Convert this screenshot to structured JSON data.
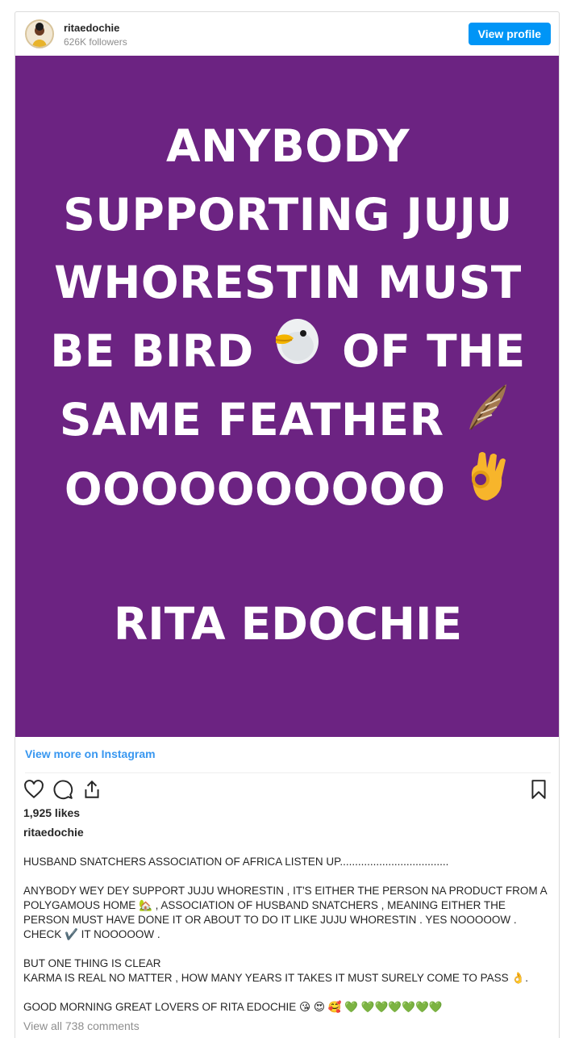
{
  "header": {
    "username": "ritaedochie",
    "followers": "626K followers",
    "view_profile_label": "View profile"
  },
  "post_image": {
    "background": "#6c2382",
    "lines": [
      "ANYBODY",
      "SUPPORTING JUJU",
      "WHORESTIN MUST",
      "BE BIRD",
      "OF THE",
      "SAME FEATHER",
      "OOOOOOOOOO",
      "RITA EDOCHIE"
    ],
    "emojis": [
      "bird-emoji",
      "feather-emoji",
      "ok-hand-emoji"
    ]
  },
  "links": {
    "view_more": "View more on Instagram",
    "view_all_comments": "View all 738 comments"
  },
  "actions": {
    "icons": [
      "heart-icon",
      "comment-icon",
      "share-icon",
      "bookmark-icon"
    ]
  },
  "stats": {
    "likes": "1,925 likes"
  },
  "caption": {
    "username": "ritaedochie",
    "p1": "HUSBAND SNATCHERS ASSOCIATION OF AFRICA LISTEN UP....................................",
    "p2": "ANYBODY WEY DEY SUPPORT JUJU WHORESTIN , IT'S EITHER THE PERSON NA PRODUCT FROM A POLYGAMOUS HOME 🏡 , ASSOCIATION OF HUSBAND SNATCHERS , MEANING EITHER THE PERSON MUST HAVE DONE IT OR ABOUT TO DO IT LIKE JUJU WHORESTIN . YES NOOOOOW . CHECK ✔️ IT NOOOOOW .",
    "p3a": "BUT ONE THING IS CLEAR",
    "p3b": "KARMA IS REAL NO MATTER , HOW MANY YEARS IT TAKES IT MUST SURELY COME TO PASS 👌.",
    "p4": "GOOD MORNING GREAT LOVERS OF RITA EDOCHIE 😘 😍 🥰 💚 💚💚💚💚💚💚"
  },
  "colors": {
    "accent": "#0095f6",
    "link": "#3897f0",
    "muted": "#8e8e8e",
    "purple": "#6c2382"
  }
}
